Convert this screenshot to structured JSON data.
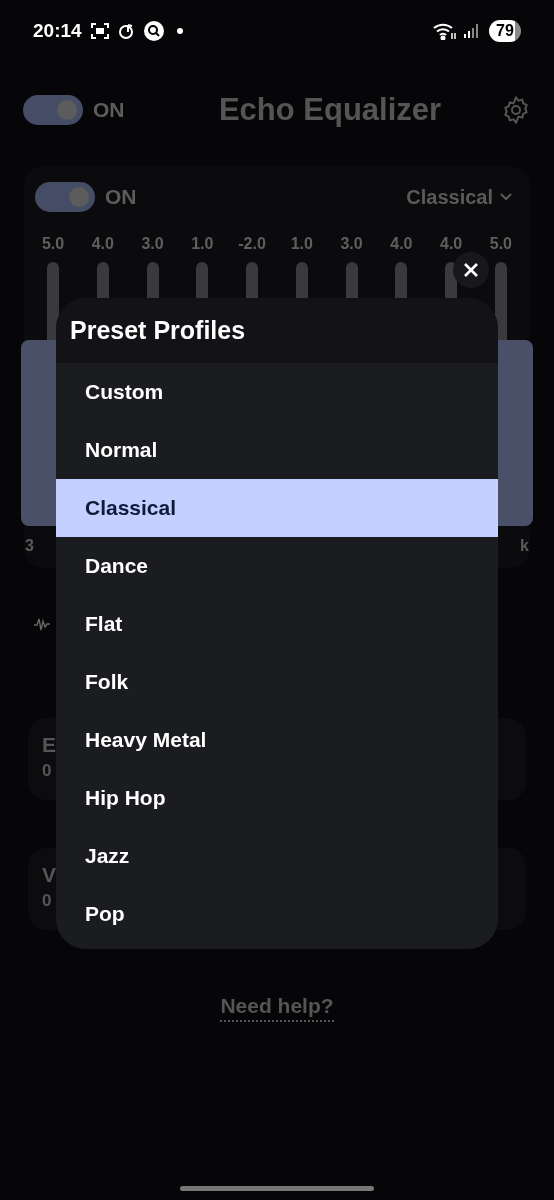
{
  "status_bar": {
    "time": "20:14",
    "battery": "79"
  },
  "header": {
    "power_toggle": {
      "on": true,
      "label": "ON"
    },
    "title": "Echo Equalizer"
  },
  "equalizer": {
    "toggle": {
      "on": true,
      "label": "ON"
    },
    "preset": "Classical",
    "gains": [
      "5.0",
      "4.0",
      "3.0",
      "1.0",
      "-2.0",
      "1.0",
      "3.0",
      "4.0",
      "4.0",
      "5.0"
    ],
    "freq_labels": [
      "3",
      "k"
    ]
  },
  "cards": [
    {
      "title": "E",
      "value": "0"
    },
    {
      "title": "V",
      "value": "0"
    }
  ],
  "help_link": "Need help?",
  "preset_dialog": {
    "title": "Preset Profiles",
    "profiles": [
      {
        "label": "Custom",
        "selected": false
      },
      {
        "label": "Normal",
        "selected": false
      },
      {
        "label": "Classical",
        "selected": true
      },
      {
        "label": "Dance",
        "selected": false
      },
      {
        "label": "Flat",
        "selected": false
      },
      {
        "label": "Folk",
        "selected": false
      },
      {
        "label": "Heavy Metal",
        "selected": false
      },
      {
        "label": "Hip Hop",
        "selected": false
      },
      {
        "label": "Jazz",
        "selected": false
      },
      {
        "label": "Pop",
        "selected": false
      }
    ]
  }
}
